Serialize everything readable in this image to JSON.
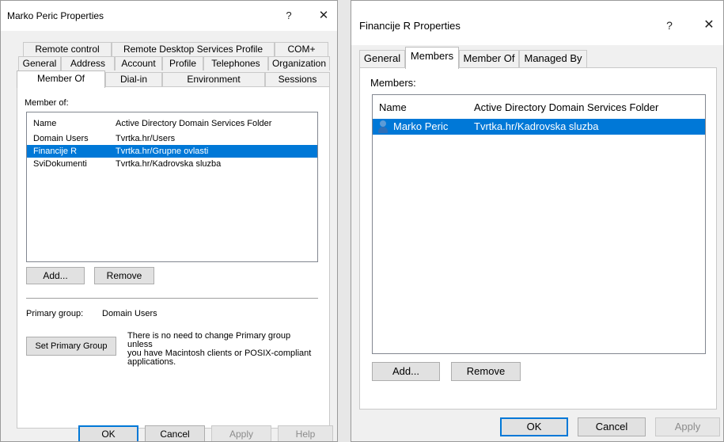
{
  "left": {
    "title": "Marko Peric Properties",
    "help": "?",
    "close": "✕",
    "tabs_row1": [
      "Remote control",
      "Remote Desktop Services Profile",
      "COM+"
    ],
    "tabs_row2": [
      "General",
      "Address",
      "Account",
      "Profile",
      "Telephones",
      "Organization"
    ],
    "tabs_row3": [
      "Member Of",
      "Dial-in",
      "Environment",
      "Sessions"
    ],
    "member_of_label": "Member of:",
    "columns": [
      "Name",
      "Active Directory Domain Services Folder"
    ],
    "rows": [
      {
        "name": "Domain Users",
        "folder": "Tvrtka.hr/Users"
      },
      {
        "name": "Financije R",
        "folder": "Tvrtka.hr/Grupne ovlasti"
      },
      {
        "name": "SviDokumenti",
        "folder": "Tvrtka.hr/Kadrovska sluzba"
      }
    ],
    "add": "Add...",
    "remove": "Remove",
    "primary_group_label": "Primary group:",
    "primary_group_value": "Domain Users",
    "set_primary": "Set Primary Group",
    "note": [
      "There is no need to change Primary group unless",
      "you have Macintosh clients or POSIX-compliant",
      "applications."
    ],
    "ok": "OK",
    "cancel": "Cancel",
    "apply": "Apply",
    "helpbtn": "Help"
  },
  "right": {
    "title": "Financije R Properties",
    "help": "?",
    "close": "✕",
    "tabs": [
      "General",
      "Members",
      "Member Of",
      "Managed By"
    ],
    "members_label": "Members:",
    "columns": [
      "Name",
      "Active Directory Domain Services Folder"
    ],
    "rows": [
      {
        "name": "Marko Peric",
        "folder": "Tvrtka.hr/Kadrovska sluzba"
      }
    ],
    "add": "Add...",
    "remove": "Remove",
    "ok": "OK",
    "cancel": "Cancel",
    "apply": "Apply"
  },
  "colors": {
    "selection": "#0078d7",
    "dialog": "#f0f0f0",
    "accent_user": "#2f6fb7"
  }
}
